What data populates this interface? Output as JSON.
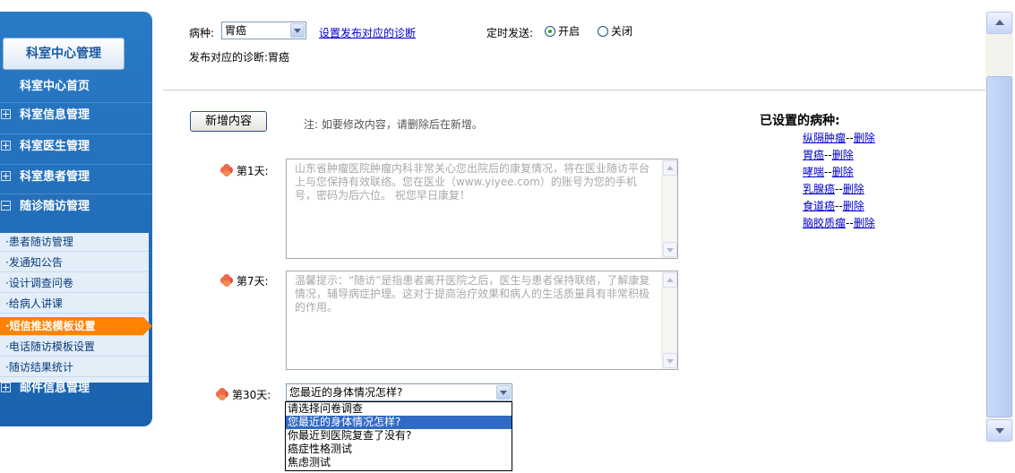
{
  "sidebar": {
    "title": "科室中心管理",
    "home": "科室中心首页",
    "items": [
      {
        "label": "科室信息管理",
        "expanded": false
      },
      {
        "label": "科室医生管理",
        "expanded": false
      },
      {
        "label": "科室患者管理",
        "expanded": false
      },
      {
        "label": "随诊随访管理",
        "expanded": true
      },
      {
        "label": "邮件信息管理",
        "expanded": false
      }
    ],
    "subitems": [
      {
        "label": "·患者随访管理",
        "active": false
      },
      {
        "label": "·发通知公告",
        "active": false
      },
      {
        "label": "·设计调查问卷",
        "active": false
      },
      {
        "label": "·给病人讲课",
        "active": false
      },
      {
        "label": "·短信推送模板设置",
        "active": true
      },
      {
        "label": "·电话随访模板设置",
        "active": false
      },
      {
        "label": "·随访结果统计",
        "active": false
      }
    ]
  },
  "header": {
    "disease_label": "病种:",
    "disease_value": "胃癌",
    "set_diagnosis_link": "设置发布对应的诊断",
    "timed_send_label": "定时发送:",
    "radio_on_label": "开启",
    "radio_off_label": "关闭",
    "timed_send_on": true,
    "diagnosis_label": "发布对应的诊断:",
    "diagnosis_value": "胃癌"
  },
  "content": {
    "add_button": "新增内容",
    "note": "注: 如要修改内容，请删除后在新增。",
    "day1_label": "第1天:",
    "day1_text": "山东省肿瘤医院肿瘤内科非常关心您出院后的康复情况，将在医业随访平台上与您保持有效联络。您在医业（www.yiyee.com）的账号为您的手机号，密码为后六位。 祝您早日康复！",
    "day7_label": "第7天:",
    "day7_text": "温馨提示：“随访”是指患者离开医院之后，医生与患者保持联络，了解康复情况，辅导病症护理。这对于提高治疗效果和病人的生活质量具有非常积极的作用。",
    "day30_label": "第30天:",
    "day30_value": "您最近的身体情况怎样?",
    "day30_options": [
      {
        "label": "请选择问卷调查",
        "selected": false
      },
      {
        "label": "您最近的身体情况怎样?",
        "selected": true
      },
      {
        "label": "你最近到医院复查了没有?",
        "selected": false
      },
      {
        "label": "癌症性格测试",
        "selected": false
      },
      {
        "label": "焦虑测试",
        "selected": false
      }
    ]
  },
  "configured": {
    "title": "已设置的病种:",
    "delete_label": "删除",
    "separator": "--",
    "items": [
      "纵隔肿瘤",
      "胃癌",
      "哮喘",
      "乳腺癌",
      "食道癌",
      "脑胶质瘤"
    ]
  },
  "colors": {
    "sidebar_blue": "#1b6ab6",
    "active_orange": "#ff8200",
    "link_blue": "#0000cc",
    "selection_blue": "#316ac5"
  }
}
